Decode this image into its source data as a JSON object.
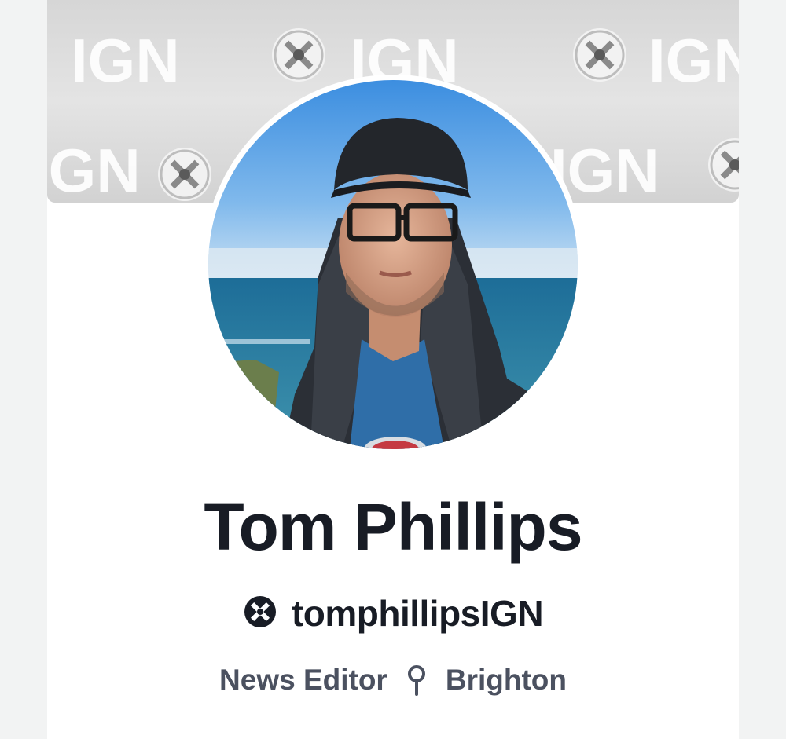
{
  "profile": {
    "name": "Tom Phillips",
    "handle": "tomphillipsIGN",
    "role": "News Editor",
    "location": "Brighton"
  },
  "banner": {
    "watermark_text": "IGN"
  },
  "icons": {
    "handle_badge": "ign-logo-icon",
    "location": "location-pin-icon"
  },
  "colors": {
    "background": "#f2f3f3",
    "card": "#ffffff",
    "name_text": "#181c25",
    "meta_text": "#4b5160"
  }
}
